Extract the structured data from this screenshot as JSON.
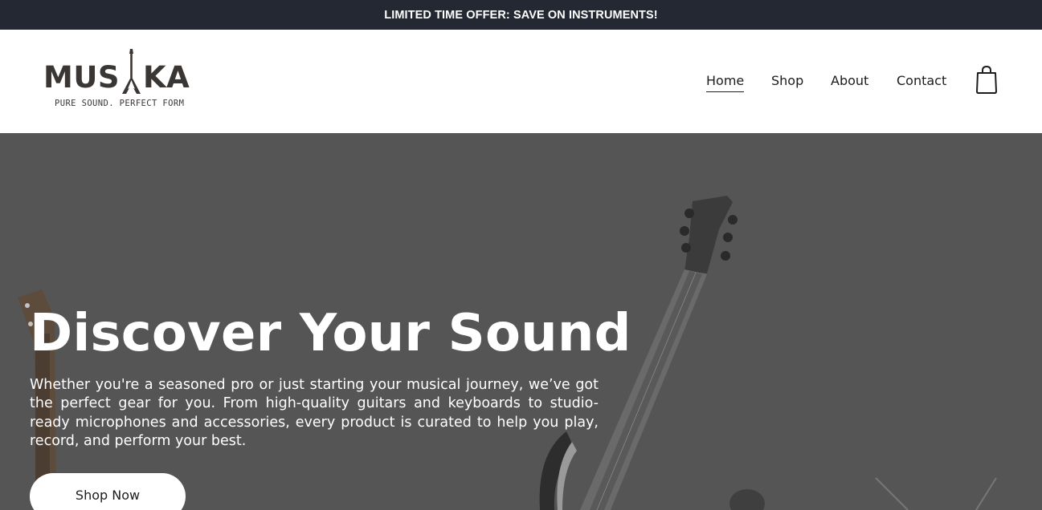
{
  "announcement": {
    "text": "LIMITED TIME OFFER: SAVE ON INSTRUMENTS!"
  },
  "header": {
    "logo": {
      "word_left": "MUS",
      "word_right": "KA",
      "tagline": "PURE SOUND. PERFECT FORM",
      "icon": "guitar-icon"
    },
    "nav": {
      "items": [
        {
          "label": "Home",
          "active": true
        },
        {
          "label": "Shop",
          "active": false
        },
        {
          "label": "About",
          "active": false
        },
        {
          "label": "Contact",
          "active": false
        }
      ]
    },
    "cart": {
      "icon": "shopping-bag-icon"
    }
  },
  "hero": {
    "title": "Discover Your Sound",
    "text": "Whether you're a seasoned pro or just starting your musical journey, we’ve got the perfect gear for you. From high-quality guitars and keyboards to studio-ready microphones and accessories, every product is curated to help you play, record, and perform your best.",
    "button_label": "Shop Now",
    "background_image": "guitars-photo",
    "overlay_color": "#555555"
  },
  "colors": {
    "announcement_bg": "#232833",
    "text_dark": "#1c1c1c",
    "logo": "#3a3634"
  }
}
